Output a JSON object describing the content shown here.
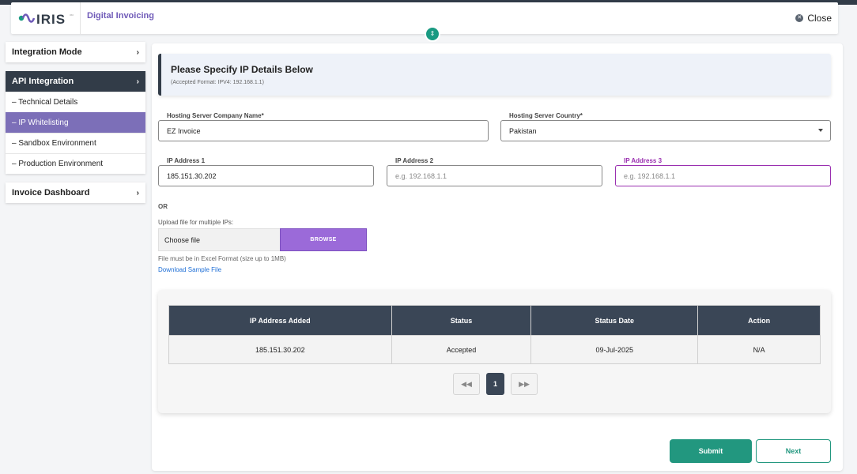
{
  "header": {
    "app_title": "Digital Invoicing",
    "close_label": "Close",
    "brand_color": "#6f5ab8"
  },
  "sidebar": {
    "integration_mode": "Integration Mode",
    "api_integration": "API Integration",
    "sub_items": [
      "– Technical Details",
      "– IP Whitelisting",
      "– Sandbox Environment",
      "– Production Environment"
    ],
    "invoice_dashboard": "Invoice Dashboard",
    "active_item": "IP Whitelisting"
  },
  "banner": {
    "title": "Please Specify IP Details Below",
    "subtitle": "(Accepted Format: IPV4: 192.168.1.1)"
  },
  "form": {
    "company_label": "Hosting Server Company Name*",
    "company_value": "EZ Invoice",
    "country_label": "Hosting Server Country*",
    "country_value": "Pakistan",
    "ip1_label": "IP Address 1",
    "ip1_value": "185.151.30.202",
    "ip2_label": "IP Address 2",
    "ip2_placeholder": "e.g. 192.168.1.1",
    "ip3_label": "IP Address 3",
    "ip3_placeholder": "e.g. 192.168.1.1"
  },
  "upload": {
    "or_text": "OR",
    "label": "Upload file for multiple IPs:",
    "choose_label": "Choose file",
    "browse_label": "BROWSE",
    "note": "File must be in Excel Format (size up to 1MB)",
    "sample_link": "Download Sample File"
  },
  "table": {
    "headers": [
      "IP Address Added",
      "Status",
      "Status Date",
      "Action"
    ],
    "rows": [
      [
        "185.151.30.202",
        "Accepted",
        "09-Jul-2025",
        "N/A"
      ]
    ]
  },
  "pagination": {
    "current_page": "1",
    "prev_icon": "double-chevron-left",
    "next_icon": "double-chevron-right"
  },
  "actions": {
    "submit_label": "Submit",
    "next_label": "Next",
    "accent_color": "#22977f"
  }
}
